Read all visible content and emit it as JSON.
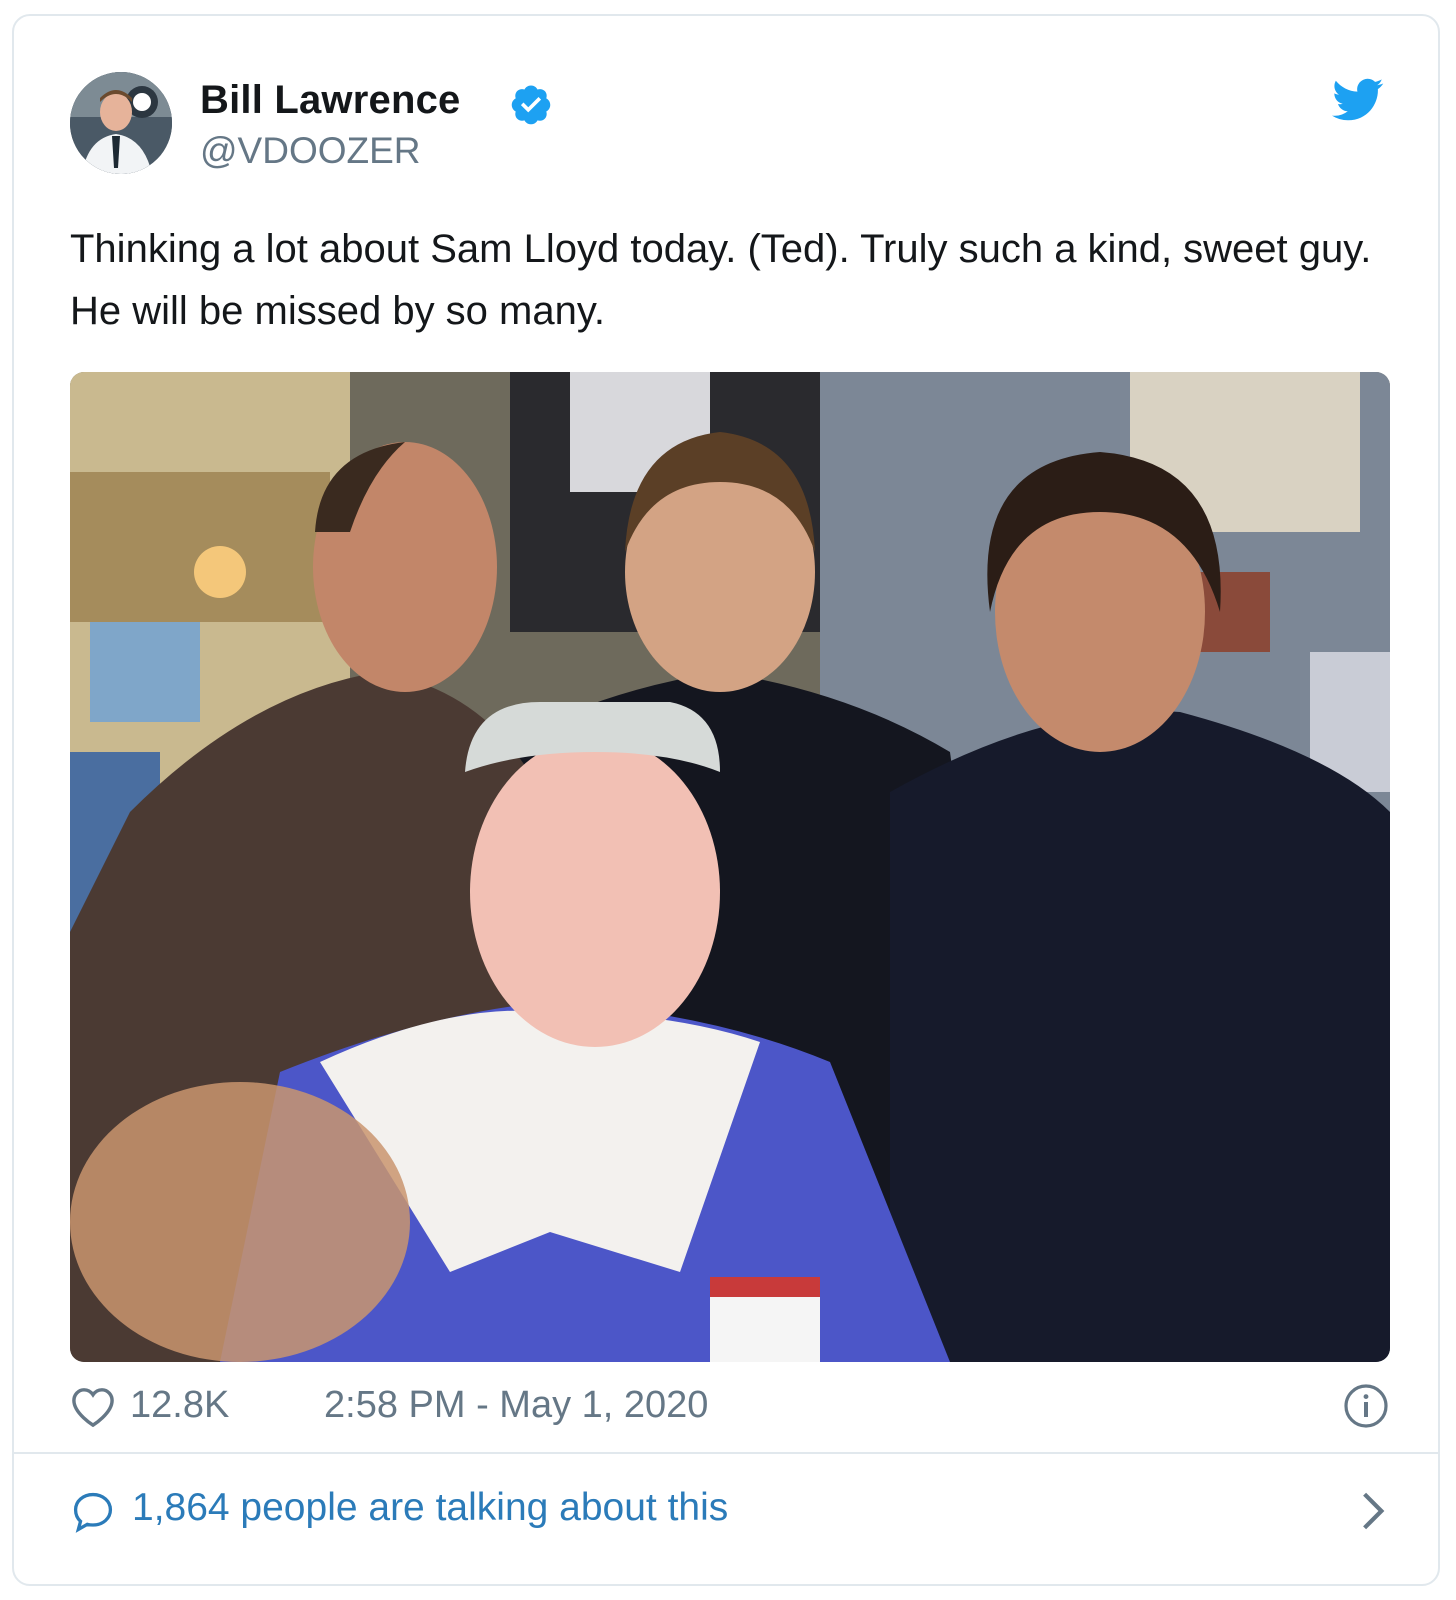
{
  "author": {
    "name": "Bill Lawrence",
    "handle": "@VDOOZER",
    "verified": true
  },
  "tweet": {
    "text": "Thinking a lot about Sam Lloyd today. (Ted). Truly such a kind, sweet guy. He will be missed by so many."
  },
  "footer": {
    "likes": "12.8K",
    "timestamp": "2:58 PM - May 1, 2020"
  },
  "conversation": {
    "label": "1,864 people are talking about this"
  },
  "icons": {
    "bird": "twitter-bird-icon",
    "verified": "verified-badge-icon",
    "heart": "heart-icon",
    "info": "info-icon",
    "bubble": "speech-bubble-icon",
    "chevron": "chevron-right-icon"
  },
  "colors": {
    "accent": "#1da1f2",
    "link": "#2b7bb9",
    "muted": "#657786",
    "text": "#14171a",
    "border": "#e1e8ed"
  }
}
